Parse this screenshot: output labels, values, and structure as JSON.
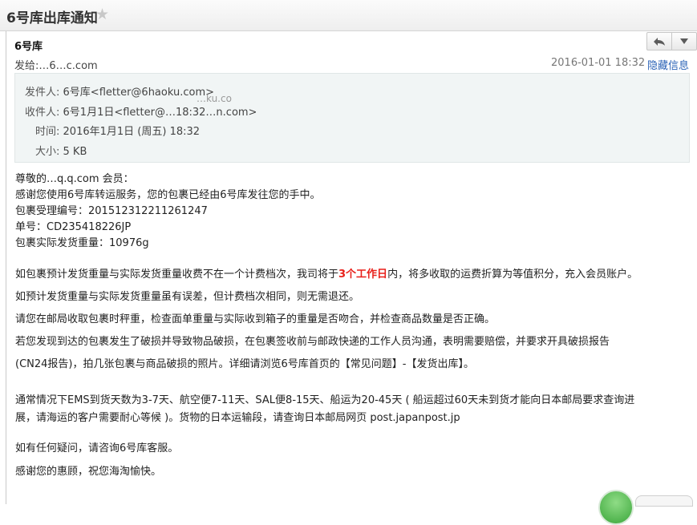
{
  "header": {
    "subject": "6号库出库通知"
  },
  "message": {
    "from_display": "6号库",
    "to_line": "发给:…6…c.com",
    "datetime": "2016-01-01 18:32",
    "hide_details": "隐藏信息"
  },
  "details": {
    "from_label": "发件人:",
    "from_value": "6号库<fletter@6haoku.com>",
    "to_label": "收件人:",
    "to_value": "6号1月1日<fletter@…18:32…n.com>",
    "to_ghost": "…ku.co",
    "time_label": "时间:",
    "time_value": "2016年1月1日 (周五) 18:32",
    "size_label": "大小:",
    "size_value": "5 KB"
  },
  "body": {
    "greeting": "尊敬的…q.q.com 会员：",
    "line1": "感谢您使用6号库转运服务，您的包裹已经由6号库发往您的手中。",
    "line2": "包裹受理编号：201512312211261247",
    "line3": "单号：CD235418226JP",
    "line4": "包裹实际发货重量：10976g",
    "p1_pre": "如包裹预计发货重量与实际发货重量收费不在一个计费档次，我司将于",
    "p1_red": "3个工作日",
    "p1_post": "内，将多收取的运费折算为等值积分，充入会员账户。",
    "p2": "如预计发货重量与实际发货重量虽有误差，但计费档次相同，则无需退还。",
    "p3": "请您在邮局收取包裹时秤重，检查面单重量与实际收到箱子的重量是否吻合，并检查商品数量是否正确。",
    "p4a": "若您发现到达的包裹发生了破损并导致物品破损，在包裹签收前与邮政快递的工作人员沟通，表明需要赔偿，并要求开具破损报告",
    "p4b": "(CN24报告)，拍几张包裹与商品破损的照片。详细请浏览6号库首页的【常见问题】-【发货出库】。",
    "p5a": "通常情况下EMS到货天数为3-7天、航空便7-11天、SAL便8-15天、船运为20-45天 ( 船运超过60天未到货才能向日本邮局要求查询进",
    "p5b": "展，请海运的客户需要耐心等候 )。货物的日本运输段，请查询日本邮局网页 post.japanpost.jp",
    "p6": "如有任何疑问，请咨询6号库客服。",
    "p7": "感谢您的惠顾，祝您海淘愉快。"
  },
  "icons": {
    "star": "star-icon",
    "reply": "reply-icon",
    "more": "chevron-down-icon"
  }
}
